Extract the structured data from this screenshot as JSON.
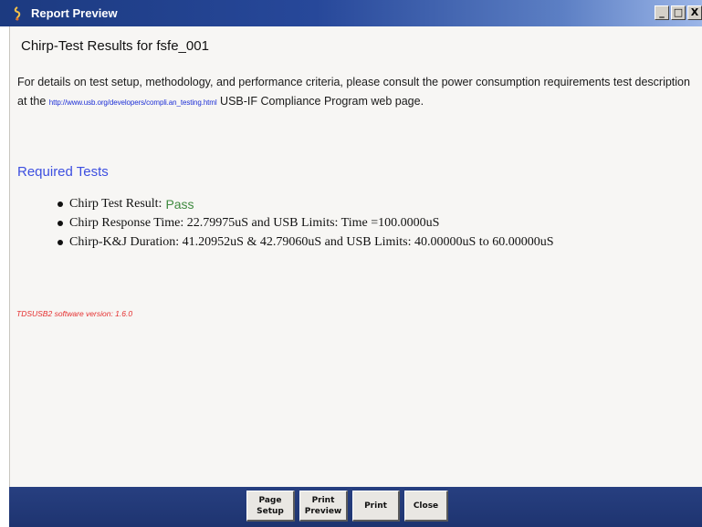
{
  "window": {
    "title": "Report Preview",
    "controls": {
      "minimize": "_",
      "maximize": "□",
      "close": "X"
    }
  },
  "report": {
    "title": "Chirp-Test Results for fsfe_001",
    "intro_part1": "For details on test setup, methodology, and performance criteria, please consult the power consumption requirements test description at the",
    "intro_link": "http://www.usb.org/developers/compli.an_testing.html",
    "intro_part2": "USB-IF Compliance Program web page."
  },
  "required_tests": {
    "heading": "Required Tests",
    "items": [
      {
        "label": "Chirp Test Result:",
        "value": "Pass"
      },
      {
        "label": "Chirp Response Time: 22.79975uS and USB Limits: Time =100.0000uS"
      },
      {
        "label": "Chirp-K&J Duration: 41.20952uS & 42.79060uS and USB Limits: 40.00000uS to 60.00000uS"
      }
    ]
  },
  "software_version": "TDSUSB2 software version: 1.6.0",
  "buttons": {
    "page_setup_line1": "Page",
    "page_setup_line2": "Setup",
    "print_preview_line1": "Print",
    "print_preview_line2": "Preview",
    "print": "Print",
    "close": "Close"
  },
  "colors": {
    "title_bar": "#27489a",
    "heading": "#3d4fe0",
    "pass": "#3f8a3f",
    "version_text": "#e52f2f",
    "footer": "#273f80"
  }
}
